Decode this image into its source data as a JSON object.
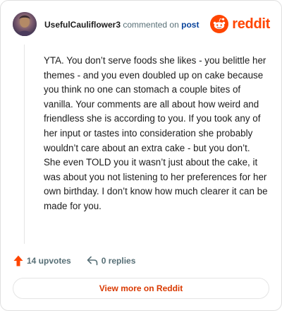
{
  "comment": {
    "username": "UsefulCauliflower3",
    "commented_on_text": "commented on",
    "post_link_text": "post",
    "body": "YTA. You don’t serve foods she likes - you belittle her themes - and you even doubled up on cake because you think no one can stomach a couple bites of vanilla. Your comments are all about how weird and friendless she is according to you. If you took any of her input or tastes into consideration she probably wouldn’t care about an extra cake - but you don’t. She even TOLD you it wasn’t just about the cake, it was about you not listening to her preferences for her own birthday. I don’t know how much clearer it can be made for you."
  },
  "brand": {
    "name": "reddit",
    "color": "#ff4500"
  },
  "actions": {
    "upvotes_label": "14 upvotes",
    "replies_label": "0 replies"
  },
  "footer": {
    "view_more_label": "View more on Reddit"
  },
  "icons": {
    "avatar": "user-avatar",
    "logo": "reddit-snoo-icon",
    "upvote": "upvote-arrow-icon",
    "reply": "reply-arrow-icon"
  },
  "colors": {
    "upvote": "#ff4500",
    "link": "#0a449b",
    "view_more_text": "#d93900",
    "muted": "#576f76"
  }
}
